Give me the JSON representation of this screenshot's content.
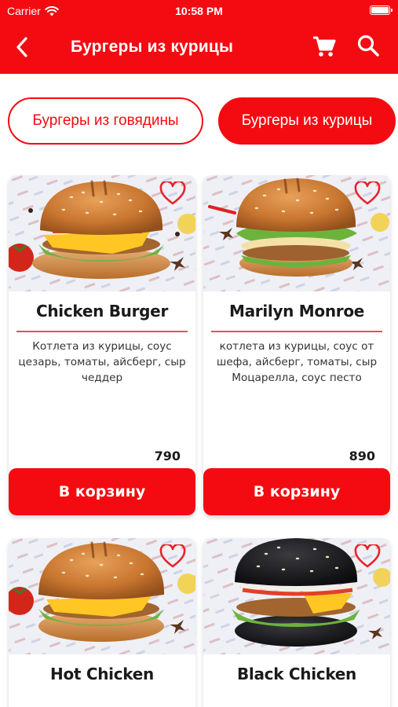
{
  "status_bar": {
    "carrier": "Carrier",
    "time": "10:58 PM"
  },
  "header": {
    "title": "Бургеры из курицы"
  },
  "tabs": [
    {
      "label": "Бургеры из говядины",
      "active": false
    },
    {
      "label": "Бургеры из курицы",
      "active": true
    }
  ],
  "colors": {
    "accent": "#f40b11",
    "divider": "#ee4d4d"
  },
  "products": [
    {
      "name": "Chicken Burger",
      "description": "Котлета из курицы, соус цезарь, томаты, айсберг, сыр чеддер",
      "price": "790",
      "button": "В корзину",
      "bun": "sesame-brown"
    },
    {
      "name": "Marilyn Monroe",
      "description": "котлета из курицы, соус от шефа, айсберг, томаты, сыр Моцарелла, соус песто",
      "price": "890",
      "button": "В корзину",
      "bun": "sesame-brown"
    },
    {
      "name": "Hot Chicken",
      "description": "",
      "price": "",
      "button": "",
      "bun": "sesame-brown"
    },
    {
      "name": "Black Chicken",
      "description": "",
      "price": "",
      "button": "",
      "bun": "black"
    }
  ]
}
